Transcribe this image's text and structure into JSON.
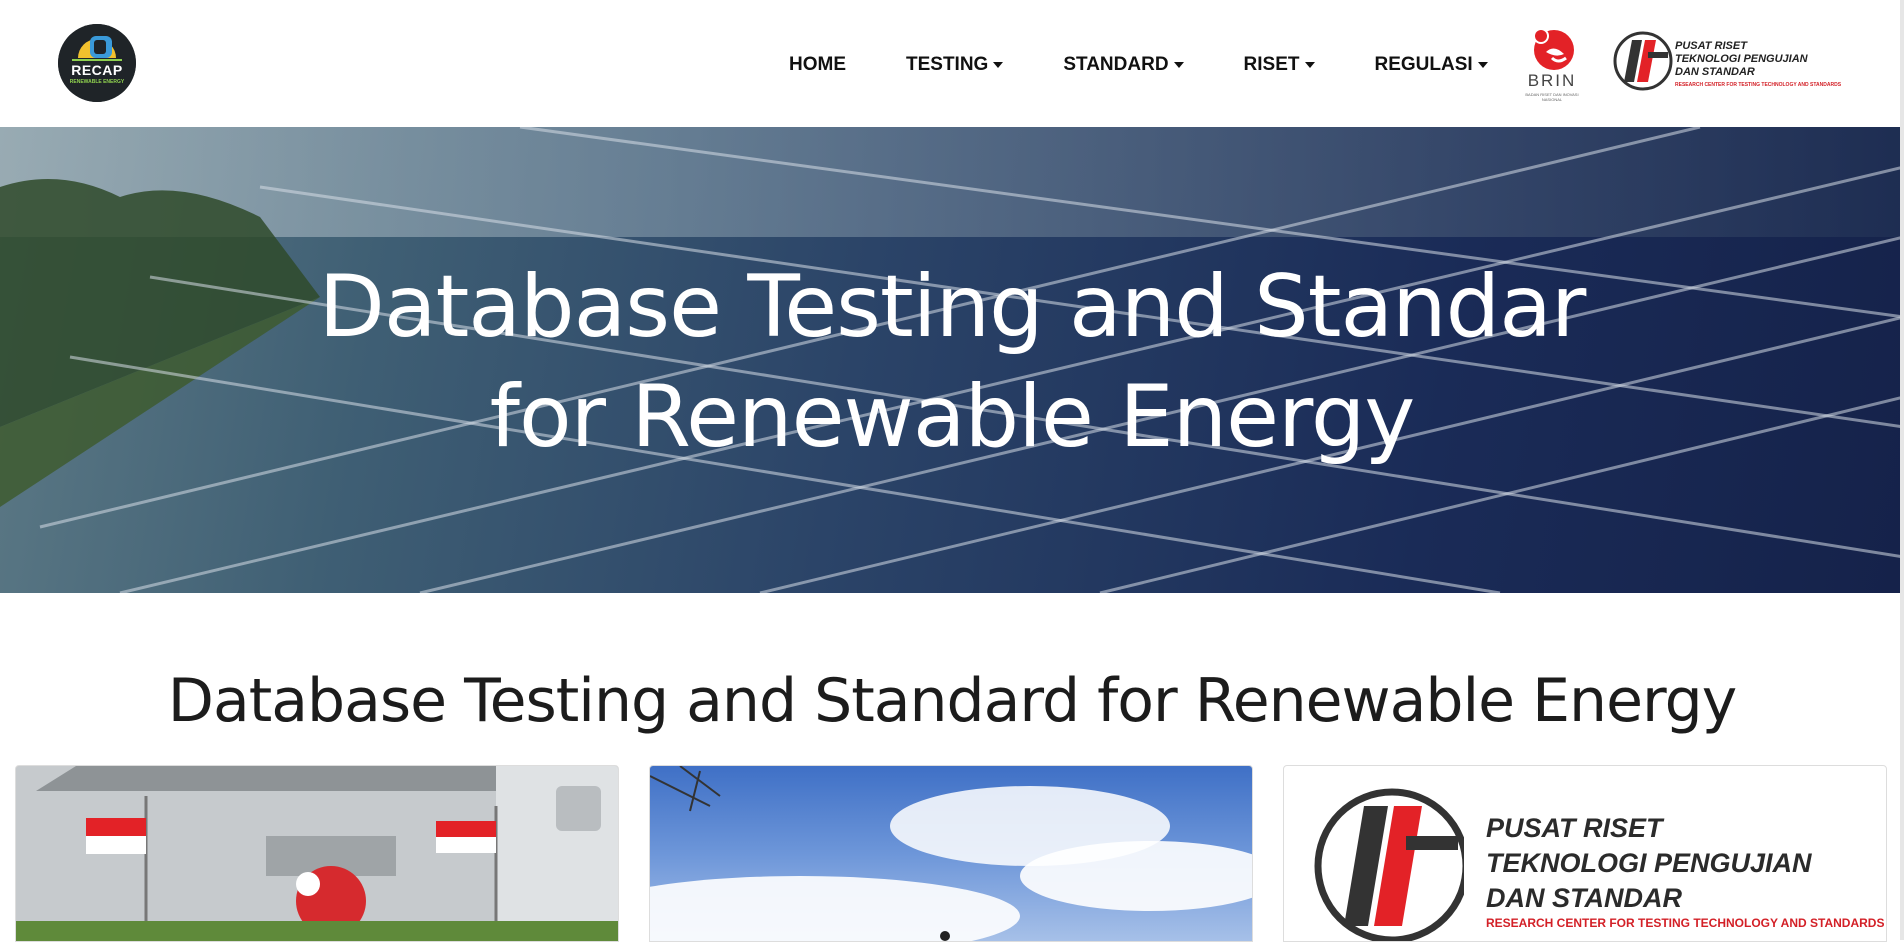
{
  "header": {
    "logo": {
      "name": "RECAP",
      "subtitle": "RENEWABLE ENERGY"
    },
    "nav": [
      {
        "label": "HOME",
        "has_dropdown": false
      },
      {
        "label": "TESTING",
        "has_dropdown": true
      },
      {
        "label": "STANDARD",
        "has_dropdown": true
      },
      {
        "label": "RISET",
        "has_dropdown": true
      },
      {
        "label": "REGULASI",
        "has_dropdown": true
      }
    ],
    "brin_logo": {
      "name": "BRIN",
      "subtitle": "BADAN RISET DAN INOVASI NASIONAL"
    },
    "center_logo": {
      "line1": "PUSAT RISET",
      "line2": "TEKNOLOGI PENGUJIAN",
      "line3": "DAN STANDAR",
      "tagline": "RESEARCH CENTER FOR TESTING TECHNOLOGY AND STANDARDS"
    }
  },
  "hero": {
    "title": "Database Testing and Standar for Renewable Energy"
  },
  "section": {
    "title": "Database Testing and Standard for Renewable Energy"
  },
  "cards": [
    {
      "image": "building-photo"
    },
    {
      "image": "sky-photo"
    },
    {
      "image": "center-logo",
      "line1": "PUSAT RISET",
      "line2": "TEKNOLOGI PENGUJIAN",
      "line3": "DAN STANDAR",
      "tagline": "RESEARCH CENTER FOR TESTING TECHNOLOGY AND STANDARDS"
    }
  ],
  "colors": {
    "brand_red": "#d32027",
    "nav_text": "#111111",
    "hero_dark": "#15224a"
  }
}
